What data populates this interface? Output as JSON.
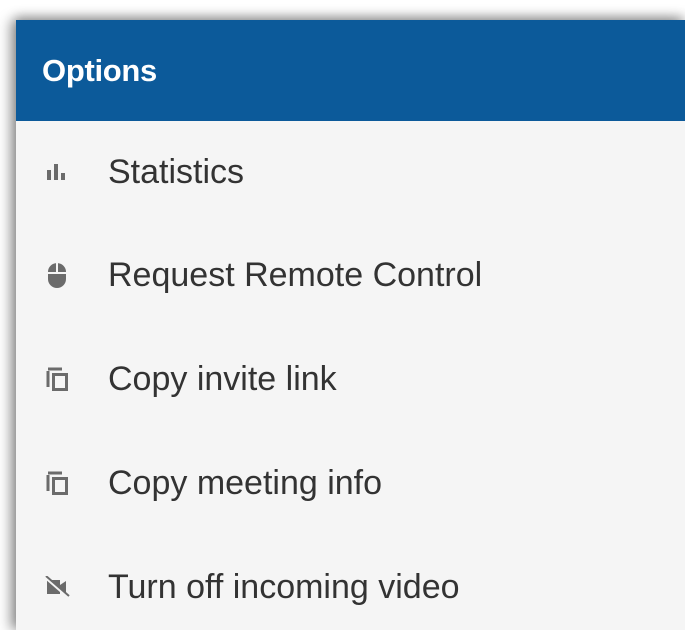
{
  "header": {
    "title": "Options",
    "background": "#0c5a9a"
  },
  "menu": {
    "icon_color": "#6b6b6b",
    "items": [
      {
        "label": "Statistics",
        "icon": "bar-chart-icon"
      },
      {
        "label": "Request Remote Control",
        "icon": "mouse-icon"
      },
      {
        "label": "Copy invite link",
        "icon": "copy-icon"
      },
      {
        "label": "Copy meeting info",
        "icon": "copy-icon"
      },
      {
        "label": "Turn off incoming video",
        "icon": "video-off-icon"
      }
    ]
  }
}
